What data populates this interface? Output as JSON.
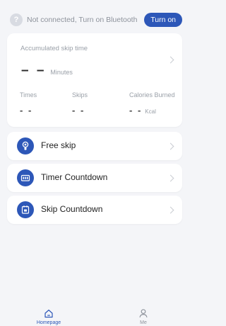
{
  "bluetooth": {
    "message": "Not connected, Turn on Bluetooth",
    "help_glyph": "?",
    "button_label": "Turn on"
  },
  "summary": {
    "accumulated_label": "Accumulated skip time",
    "accumulated_value": "– –",
    "accumulated_unit": "Minutes",
    "stats": [
      {
        "label": "Times",
        "value": "- -",
        "unit": ""
      },
      {
        "label": "Skips",
        "value": "- -",
        "unit": ""
      },
      {
        "label": "Calories Burned",
        "value": "- -",
        "unit": "Kcal"
      }
    ]
  },
  "modes": [
    {
      "label": "Free skip",
      "icon": "rope-icon"
    },
    {
      "label": "Timer Countdown",
      "icon": "timer-icon"
    },
    {
      "label": "Skip Countdown",
      "icon": "counter-icon"
    }
  ],
  "tabs": [
    {
      "label": "Homepage",
      "icon": "home-icon",
      "active": true
    },
    {
      "label": "Me",
      "icon": "person-icon",
      "active": false
    }
  ],
  "colors": {
    "accent": "#2d57b8",
    "background": "#f4f5f8",
    "card": "#ffffff",
    "muted_text": "#9aa0a8"
  }
}
